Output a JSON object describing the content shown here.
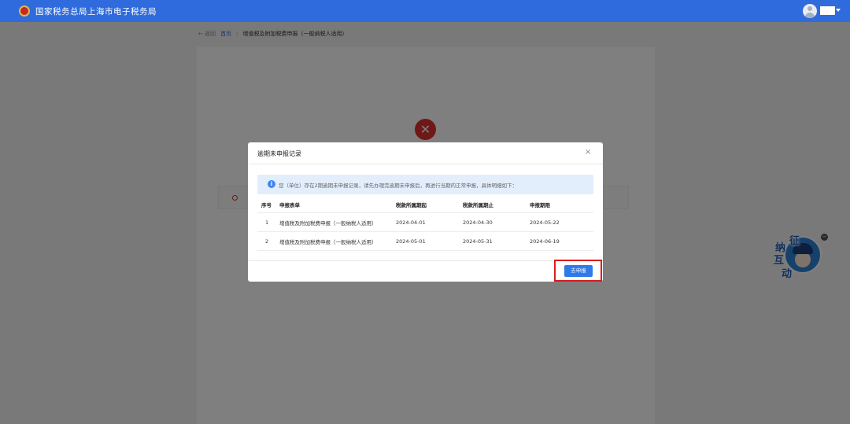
{
  "header": {
    "site_title": "国家税务总局上海市电子税务局"
  },
  "breadcrumb": {
    "back": "← 返回",
    "home": "首页",
    "separator": "/",
    "current": "增值税及附加税费申报（一般纳税人适用）"
  },
  "mascot": {
    "chars": [
      "征",
      "纳",
      "互",
      "动"
    ],
    "close": "−"
  },
  "modal": {
    "title": "逾期未申报记录",
    "close": "×",
    "notice": "您（单位）存在2期逾期未申报记录，请先办理完逾期未申报后，再进行当期的正常申报，具体明细如下：",
    "columns": [
      "序号",
      "申报表单",
      "税款所属期起",
      "税款所属期止",
      "申报期限"
    ],
    "rows": [
      {
        "seq": "1",
        "form": "增值税及附加税费申报（一般纳税人适用）",
        "start": "2024-04-01",
        "end": "2024-04-30",
        "due": "2024-05-22"
      },
      {
        "seq": "2",
        "form": "增值税及附加税费申报（一般纳税人适用）",
        "start": "2024-05-01",
        "end": "2024-05-31",
        "due": "2024-06-19"
      }
    ],
    "declare_button": "去申报"
  },
  "icons": {
    "error": "close-circle-icon",
    "info": "info-icon",
    "avatar": "user-avatar-icon"
  },
  "colors": {
    "header_bg": "#2f6bdc",
    "primary": "#2f7ae8",
    "error": "#e0302f",
    "highlight": "#d81c1c",
    "notice_bg": "#e3eefc"
  }
}
